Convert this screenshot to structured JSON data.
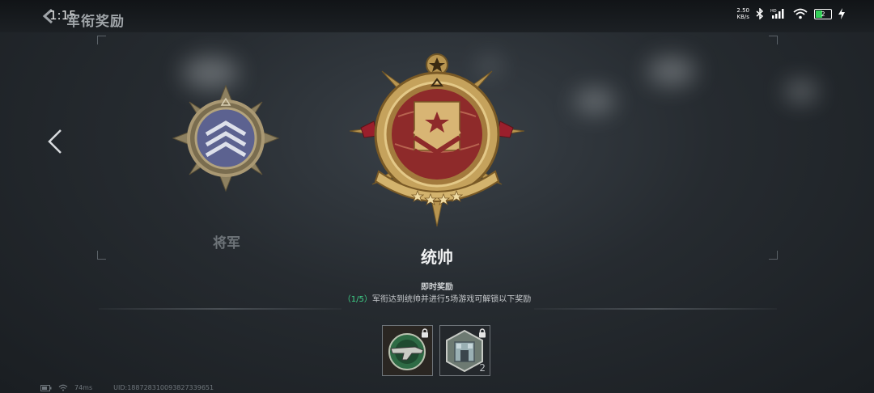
{
  "statusbar": {
    "time": "1:15",
    "net_speed_value": "2.50",
    "net_speed_unit": "KB/s",
    "battery_level": "2",
    "icons": [
      "bluetooth-icon",
      "hd-signal-icon",
      "wifi-icon",
      "battery-icon",
      "charging-icon"
    ]
  },
  "header": {
    "title": "军衔奖励"
  },
  "ranks": {
    "previous": {
      "name": "将军"
    },
    "current": {
      "name": "统帅"
    }
  },
  "reward": {
    "heading": "即时奖励",
    "progress": "（1/5）",
    "description": "军衔达到统帅并进行5场游戏可解锁以下奖励"
  },
  "items": [
    {
      "icon": "weapon-skin-icon",
      "locked": true,
      "count": ""
    },
    {
      "icon": "building-icon",
      "locked": true,
      "count": "2"
    }
  ],
  "footer": {
    "ping": "74ms",
    "uid": "UID:188728310093827339651"
  },
  "colors": {
    "progress_accent": "#3fd58a",
    "gold": "#c9a560",
    "crimson": "#8e2a2a",
    "item_green": "#2e6b45"
  }
}
